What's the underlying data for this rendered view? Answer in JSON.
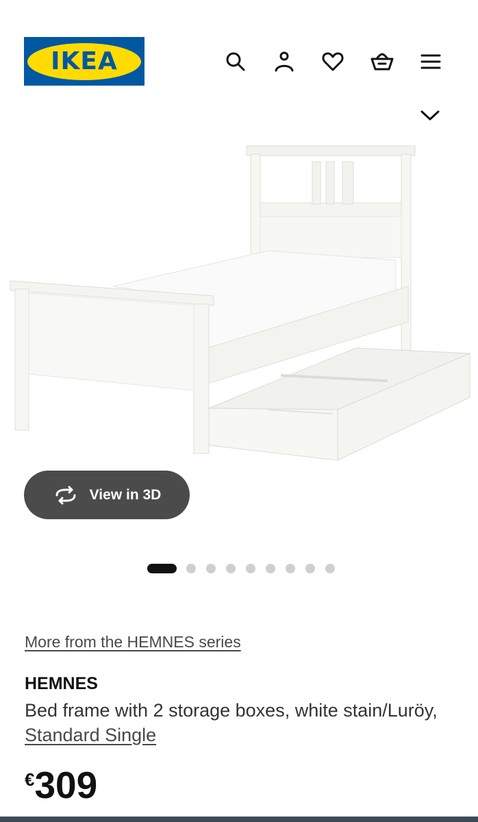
{
  "header": {
    "logo_text": "IKEA",
    "icons": [
      "search-icon",
      "profile-icon",
      "heart-icon",
      "basket-icon",
      "menu-icon"
    ],
    "brand_colors": {
      "blue": "#0058a3",
      "yellow": "#ffdb00"
    }
  },
  "gallery": {
    "image_alt": "HEMNES bed frame with storage boxes, white",
    "view3d_label": "View in 3D",
    "total_images": 9,
    "active_index": 0
  },
  "product": {
    "series_link": "More from the HEMNES series",
    "name": "HEMNES",
    "description": "Bed frame with 2 storage boxes, white stain/Luröy,",
    "size_link": "Standard Single",
    "currency": "€",
    "price": "309"
  }
}
